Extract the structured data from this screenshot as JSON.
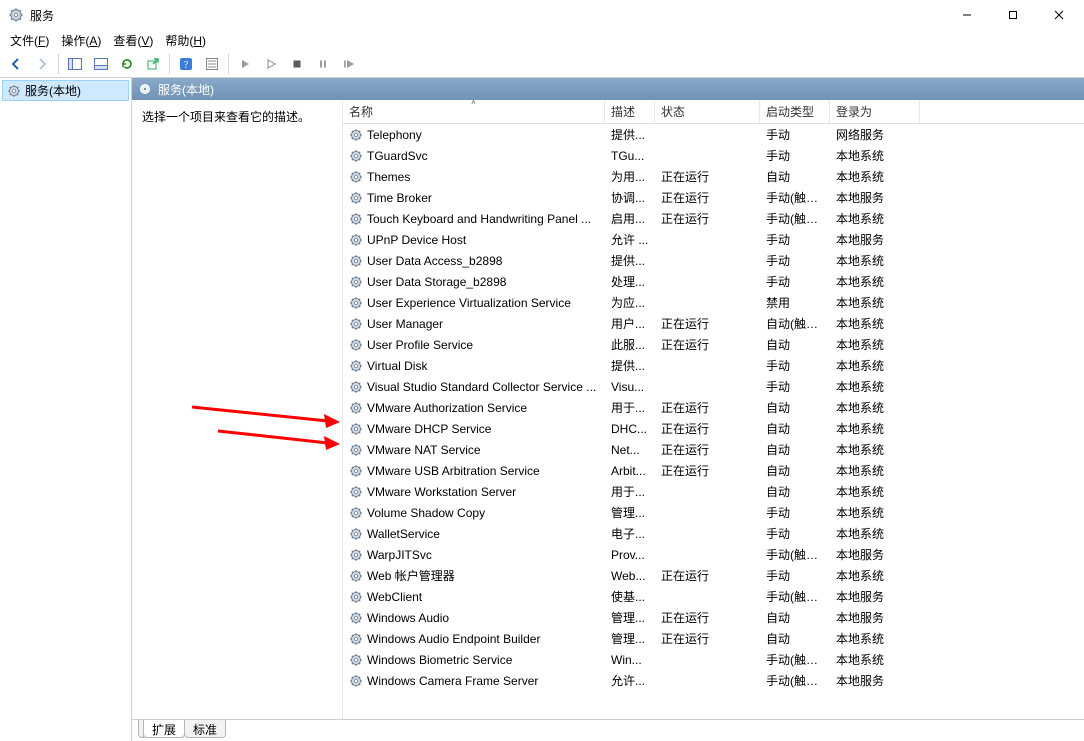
{
  "window": {
    "title": "服务",
    "buttons": {
      "min": "—",
      "max": "☐",
      "close": "✕"
    }
  },
  "menu": {
    "file": "文件(F)",
    "action": "操作(A)",
    "view": "查看(V)",
    "help": "帮助(H)"
  },
  "toolbar": {
    "back": "back",
    "forward": "forward",
    "show_hide_tree": "show-hide-tree",
    "show_hide_console": "show-hide-console",
    "refresh": "refresh",
    "export": "export",
    "help": "help",
    "properties": "properties",
    "play": "play",
    "pause": "pause",
    "stop": "stop",
    "pause2": "pause2",
    "restart": "restart"
  },
  "tree": {
    "root_label": "服务(本地)"
  },
  "detail_header": {
    "label": "服务(本地)"
  },
  "desc_pane": {
    "text": "选择一个项目来查看它的描述。"
  },
  "columns": {
    "name": "名称",
    "desc": "描述",
    "status": "状态",
    "startup": "启动类型",
    "logon": "登录为"
  },
  "tabs": {
    "extended": "扩展",
    "standard": "标准"
  },
  "services": [
    {
      "name": "Telephony",
      "desc": "提供...",
      "status": "",
      "startup": "手动",
      "logon": "网络服务"
    },
    {
      "name": "TGuardSvc",
      "desc": "TGu...",
      "status": "",
      "startup": "手动",
      "logon": "本地系统"
    },
    {
      "name": "Themes",
      "desc": "为用...",
      "status": "正在运行",
      "startup": "自动",
      "logon": "本地系统"
    },
    {
      "name": "Time Broker",
      "desc": "协调...",
      "status": "正在运行",
      "startup": "手动(触发...",
      "logon": "本地服务"
    },
    {
      "name": "Touch Keyboard and Handwriting Panel ...",
      "desc": "启用...",
      "status": "正在运行",
      "startup": "手动(触发...",
      "logon": "本地系统"
    },
    {
      "name": "UPnP Device Host",
      "desc": "允许 ...",
      "status": "",
      "startup": "手动",
      "logon": "本地服务"
    },
    {
      "name": "User Data Access_b2898",
      "desc": "提供...",
      "status": "",
      "startup": "手动",
      "logon": "本地系统"
    },
    {
      "name": "User Data Storage_b2898",
      "desc": "处理...",
      "status": "",
      "startup": "手动",
      "logon": "本地系统"
    },
    {
      "name": "User Experience Virtualization Service",
      "desc": "为应...",
      "status": "",
      "startup": "禁用",
      "logon": "本地系统"
    },
    {
      "name": "User Manager",
      "desc": "用户...",
      "status": "正在运行",
      "startup": "自动(触发...",
      "logon": "本地系统"
    },
    {
      "name": "User Profile Service",
      "desc": "此服...",
      "status": "正在运行",
      "startup": "自动",
      "logon": "本地系统"
    },
    {
      "name": "Virtual Disk",
      "desc": "提供...",
      "status": "",
      "startup": "手动",
      "logon": "本地系统"
    },
    {
      "name": "Visual Studio Standard Collector Service ...",
      "desc": "Visu...",
      "status": "",
      "startup": "手动",
      "logon": "本地系统"
    },
    {
      "name": "VMware Authorization Service",
      "desc": "用于...",
      "status": "正在运行",
      "startup": "自动",
      "logon": "本地系统"
    },
    {
      "name": "VMware DHCP Service",
      "desc": "DHC...",
      "status": "正在运行",
      "startup": "自动",
      "logon": "本地系统"
    },
    {
      "name": "VMware NAT Service",
      "desc": "Net...",
      "status": "正在运行",
      "startup": "自动",
      "logon": "本地系统"
    },
    {
      "name": "VMware USB Arbitration Service",
      "desc": "Arbit...",
      "status": "正在运行",
      "startup": "自动",
      "logon": "本地系统"
    },
    {
      "name": "VMware Workstation Server",
      "desc": "用于...",
      "status": "",
      "startup": "自动",
      "logon": "本地系统"
    },
    {
      "name": "Volume Shadow Copy",
      "desc": "管理...",
      "status": "",
      "startup": "手动",
      "logon": "本地系统"
    },
    {
      "name": "WalletService",
      "desc": "电子...",
      "status": "",
      "startup": "手动",
      "logon": "本地系统"
    },
    {
      "name": "WarpJITSvc",
      "desc": "Prov...",
      "status": "",
      "startup": "手动(触发...",
      "logon": "本地服务"
    },
    {
      "name": "Web 帐户管理器",
      "desc": "Web...",
      "status": "正在运行",
      "startup": "手动",
      "logon": "本地系统"
    },
    {
      "name": "WebClient",
      "desc": "使基...",
      "status": "",
      "startup": "手动(触发...",
      "logon": "本地服务"
    },
    {
      "name": "Windows Audio",
      "desc": "管理...",
      "status": "正在运行",
      "startup": "自动",
      "logon": "本地服务"
    },
    {
      "name": "Windows Audio Endpoint Builder",
      "desc": "管理...",
      "status": "正在运行",
      "startup": "自动",
      "logon": "本地系统"
    },
    {
      "name": "Windows Biometric Service",
      "desc": "Win...",
      "status": "",
      "startup": "手动(触发...",
      "logon": "本地系统"
    },
    {
      "name": "Windows Camera Frame Server",
      "desc": "允许...",
      "status": "",
      "startup": "手动(触发...",
      "logon": "本地服务"
    }
  ],
  "annotations": {
    "arrow1_target_index": 14,
    "arrow2_target_index": 15
  }
}
